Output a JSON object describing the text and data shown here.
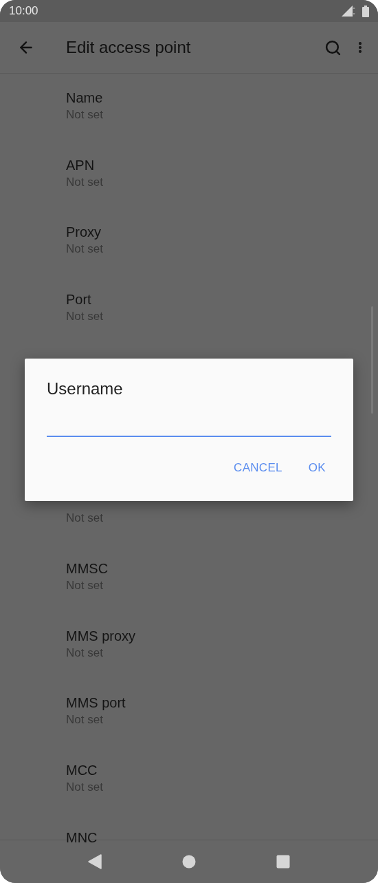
{
  "status_bar": {
    "time": "10:00"
  },
  "toolbar": {
    "title": "Edit access point"
  },
  "list_above": [
    {
      "title": "Name",
      "summary": "Not set"
    },
    {
      "title": "APN",
      "summary": "Not set"
    },
    {
      "title": "Proxy",
      "summary": "Not set"
    },
    {
      "title": "Port",
      "summary": "Not set"
    }
  ],
  "list_below": [
    {
      "summary": "Not set"
    },
    {
      "title": "MMSC",
      "summary": "Not set"
    },
    {
      "title": "MMS proxy",
      "summary": "Not set"
    },
    {
      "title": "MMS port",
      "summary": "Not set"
    },
    {
      "title": "MCC",
      "summary": "Not set"
    },
    {
      "title": "MNC"
    }
  ],
  "dialog": {
    "title": "Username",
    "buttons": [
      "CANCEL",
      "OK"
    ]
  }
}
